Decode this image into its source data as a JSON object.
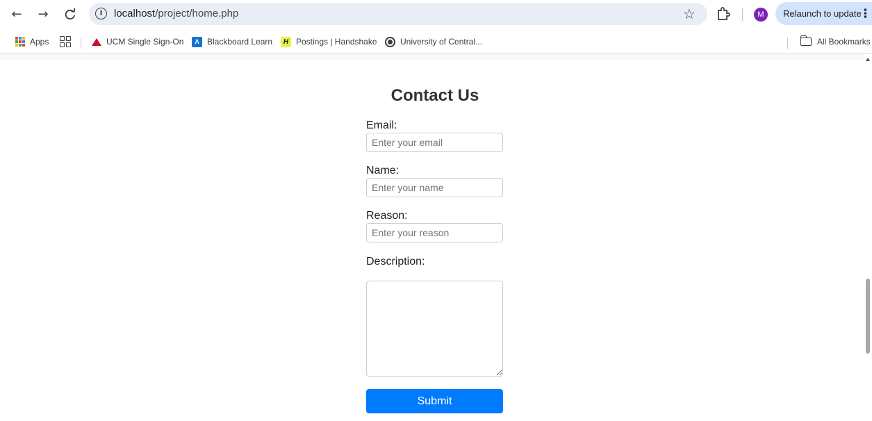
{
  "browser": {
    "url_host": "localhost",
    "url_path": "/project/home.php",
    "avatar_initial": "M",
    "relaunch_label": "Relaunch to update",
    "icons": {
      "back": "back-arrow-icon",
      "forward": "forward-arrow-icon",
      "reload": "reload-icon",
      "site_info": "info-icon",
      "bookmark_star": "star-icon",
      "extensions": "puzzle-icon",
      "menu": "kebab-menu-icon"
    }
  },
  "bookmarks": {
    "apps_label": "Apps",
    "items": [
      {
        "label": "UCM Single Sign-On",
        "icon": "ucm-icon"
      },
      {
        "label": "Blackboard Learn",
        "icon": "blackboard-icon"
      },
      {
        "label": "Postings | Handshake",
        "icon": "handshake-icon"
      },
      {
        "label": "University of Central...",
        "icon": "globe-icon"
      }
    ],
    "all_bookmarks_label": "All Bookmarks"
  },
  "form": {
    "title": "Contact Us",
    "email": {
      "label": "Email:",
      "placeholder": "Enter your email"
    },
    "name": {
      "label": "Name:",
      "placeholder": "Enter your name"
    },
    "reason": {
      "label": "Reason:",
      "placeholder": "Enter your reason"
    },
    "description": {
      "label": "Description:"
    },
    "submit_label": "Submit",
    "colors": {
      "submit_bg": "#007bff",
      "submit_text": "#ffffff",
      "title": "#333333"
    }
  }
}
